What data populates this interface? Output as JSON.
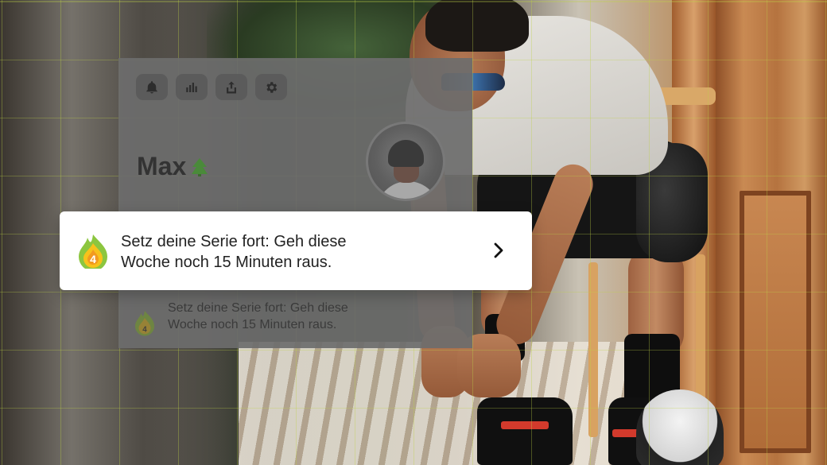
{
  "profile": {
    "name": "Max",
    "rank_icon": "tree-icon"
  },
  "toolbar": {
    "buttons": [
      {
        "icon": "bell-icon"
      },
      {
        "icon": "bar-chart-icon"
      },
      {
        "icon": "share-icon"
      },
      {
        "icon": "gear-icon"
      }
    ]
  },
  "streak": {
    "count": "4",
    "icon": "flame-icon",
    "colors": {
      "flame_outer": "#8cc63f",
      "flame_inner": "#f7c21b"
    }
  },
  "notification": {
    "line1": "Setz deine Serie fort: Geh diese",
    "line2": "Woche noch 15 Minuten raus.",
    "chevron_icon": "chevron-right-icon"
  },
  "background_card": {
    "line1": "Setz deine Serie fort: Geh diese",
    "line2": "Woche noch 15 Minuten raus."
  },
  "colors": {
    "toast_bg": "#ffffff",
    "panel_overlay": "#6c6c6c",
    "grid_accent": "#bed246",
    "tree_green": "#4a8a3a"
  }
}
